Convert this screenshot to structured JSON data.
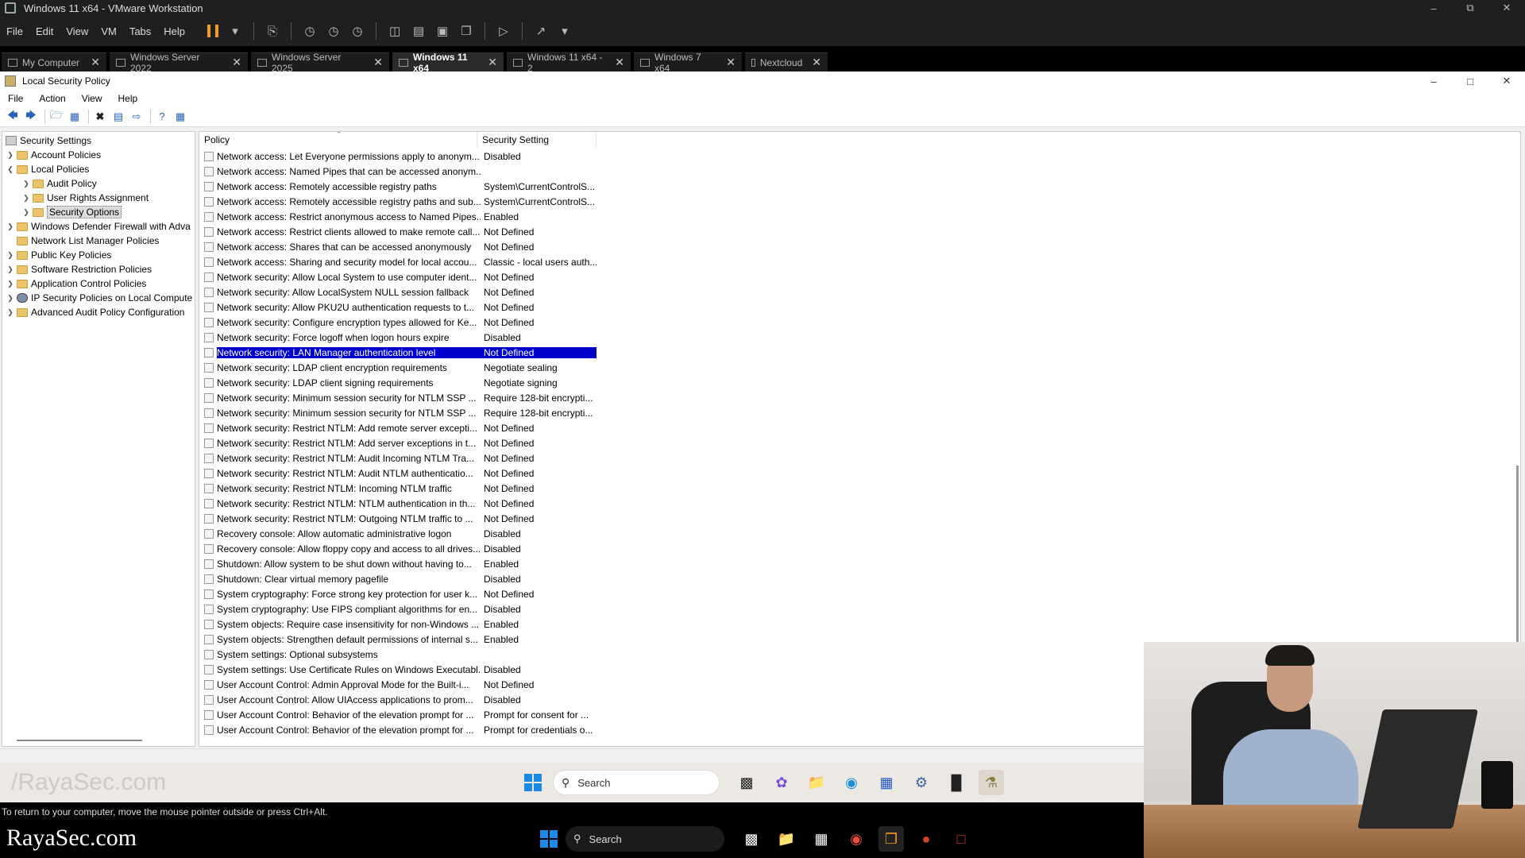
{
  "vmware": {
    "title": "Windows 11 x64 - VMware Workstation",
    "menu": [
      "File",
      "Edit",
      "View",
      "VM",
      "Tabs",
      "Help"
    ],
    "tabs": [
      {
        "label": "My Computer",
        "active": false
      },
      {
        "label": "Windows Server 2022",
        "active": false
      },
      {
        "label": "Windows Server 2025",
        "active": false
      },
      {
        "label": "Windows 11 x64",
        "active": true
      },
      {
        "label": "Windows 11 x64 - 2",
        "active": false
      },
      {
        "label": "Windows 7 x64",
        "active": false
      },
      {
        "label": "Nextcloud",
        "active": false
      }
    ],
    "hint": "To return to your computer, move the mouse pointer outside or press Ctrl+Alt."
  },
  "lsp": {
    "title": "Local Security Policy",
    "menu": [
      "File",
      "Action",
      "View",
      "Help"
    ]
  },
  "tree": [
    {
      "label": "Security Settings",
      "level": 0,
      "icon": "security-settings-icon",
      "arrow": ""
    },
    {
      "label": "Account Policies",
      "level": 1,
      "icon": "folder-icon",
      "arrow": ">"
    },
    {
      "label": "Local Policies",
      "level": 1,
      "icon": "folder-icon",
      "arrow": "v"
    },
    {
      "label": "Audit Policy",
      "level": 2,
      "icon": "folder-icon",
      "arrow": ">"
    },
    {
      "label": "User Rights Assignment",
      "level": 2,
      "icon": "folder-icon",
      "arrow": ">"
    },
    {
      "label": "Security Options",
      "level": 2,
      "icon": "folder-icon",
      "arrow": ">",
      "selected": true
    },
    {
      "label": "Windows Defender Firewall with Adva",
      "level": 1,
      "icon": "folder-icon",
      "arrow": ">"
    },
    {
      "label": "Network List Manager Policies",
      "level": 1,
      "icon": "folder-icon",
      "arrow": ""
    },
    {
      "label": "Public Key Policies",
      "level": 1,
      "icon": "folder-icon",
      "arrow": ">"
    },
    {
      "label": "Software Restriction Policies",
      "level": 1,
      "icon": "folder-icon",
      "arrow": ">"
    },
    {
      "label": "Application Control Policies",
      "level": 1,
      "icon": "folder-icon",
      "arrow": ">"
    },
    {
      "label": "IP Security Policies on Local Compute",
      "level": 1,
      "icon": "ip-security-icon",
      "arrow": ">"
    },
    {
      "label": "Advanced Audit Policy Configuration",
      "level": 1,
      "icon": "folder-icon",
      "arrow": ">"
    }
  ],
  "list": {
    "col_policy": "Policy",
    "col_setting": "Security Setting",
    "rows": [
      {
        "policy": "Network access: Let Everyone permissions apply to anonym...",
        "setting": "Disabled"
      },
      {
        "policy": "Network access: Named Pipes that can be accessed anonym...",
        "setting": ""
      },
      {
        "policy": "Network access: Remotely accessible registry paths",
        "setting": "System\\CurrentControlS..."
      },
      {
        "policy": "Network access: Remotely accessible registry paths and sub...",
        "setting": "System\\CurrentControlS..."
      },
      {
        "policy": "Network access: Restrict anonymous access to Named Pipes...",
        "setting": "Enabled"
      },
      {
        "policy": "Network access: Restrict clients allowed to make remote call...",
        "setting": "Not Defined"
      },
      {
        "policy": "Network access: Shares that can be accessed anonymously",
        "setting": "Not Defined"
      },
      {
        "policy": "Network access: Sharing and security model for local accou...",
        "setting": "Classic - local users auth..."
      },
      {
        "policy": "Network security: Allow Local System to use computer ident...",
        "setting": "Not Defined"
      },
      {
        "policy": "Network security: Allow LocalSystem NULL session fallback",
        "setting": "Not Defined"
      },
      {
        "policy": "Network security: Allow PKU2U authentication requests to t...",
        "setting": "Not Defined"
      },
      {
        "policy": "Network security: Configure encryption types allowed for Ke...",
        "setting": "Not Defined"
      },
      {
        "policy": "Network security: Force logoff when logon hours expire",
        "setting": "Disabled"
      },
      {
        "policy": "Network security: LAN Manager authentication level",
        "setting": "Not Defined",
        "selected": true
      },
      {
        "policy": "Network security: LDAP client encryption requirements",
        "setting": "Negotiate sealing"
      },
      {
        "policy": "Network security: LDAP client signing requirements",
        "setting": "Negotiate signing"
      },
      {
        "policy": "Network security: Minimum session security for NTLM SSP ...",
        "setting": "Require 128-bit encrypti..."
      },
      {
        "policy": "Network security: Minimum session security for NTLM SSP ...",
        "setting": "Require 128-bit encrypti..."
      },
      {
        "policy": "Network security: Restrict NTLM: Add remote server excepti...",
        "setting": "Not Defined"
      },
      {
        "policy": "Network security: Restrict NTLM: Add server exceptions in t...",
        "setting": "Not Defined"
      },
      {
        "policy": "Network security: Restrict NTLM: Audit Incoming NTLM Tra...",
        "setting": "Not Defined"
      },
      {
        "policy": "Network security: Restrict NTLM: Audit NTLM authenticatio...",
        "setting": "Not Defined"
      },
      {
        "policy": "Network security: Restrict NTLM: Incoming NTLM traffic",
        "setting": "Not Defined"
      },
      {
        "policy": "Network security: Restrict NTLM: NTLM authentication in th...",
        "setting": "Not Defined"
      },
      {
        "policy": "Network security: Restrict NTLM: Outgoing NTLM traffic to ...",
        "setting": "Not Defined"
      },
      {
        "policy": "Recovery console: Allow automatic administrative logon",
        "setting": "Disabled"
      },
      {
        "policy": "Recovery console: Allow floppy copy and access to all drives...",
        "setting": "Disabled"
      },
      {
        "policy": "Shutdown: Allow system to be shut down without having to...",
        "setting": "Enabled"
      },
      {
        "policy": "Shutdown: Clear virtual memory pagefile",
        "setting": "Disabled"
      },
      {
        "policy": "System cryptography: Force strong key protection for user k...",
        "setting": "Not Defined"
      },
      {
        "policy": "System cryptography: Use FIPS compliant algorithms for en...",
        "setting": "Disabled"
      },
      {
        "policy": "System objects: Require case insensitivity for non-Windows ...",
        "setting": "Enabled"
      },
      {
        "policy": "System objects: Strengthen default permissions of internal s...",
        "setting": "Enabled"
      },
      {
        "policy": "System settings: Optional subsystems",
        "setting": ""
      },
      {
        "policy": "System settings: Use Certificate Rules on Windows Executabl...",
        "setting": "Disabled"
      },
      {
        "policy": "User Account Control: Admin Approval Mode for the Built-i...",
        "setting": "Not Defined"
      },
      {
        "policy": "User Account Control: Allow UIAccess applications to prom...",
        "setting": "Disabled"
      },
      {
        "policy": "User Account Control: Behavior of the elevation prompt for ...",
        "setting": "Prompt for consent for ..."
      },
      {
        "policy": "User Account Control: Behavior of the elevation prompt for ...",
        "setting": "Prompt for credentials o..."
      }
    ]
  },
  "guest_taskbar": {
    "watermark": "/RayaSec.com",
    "search_label": "Search"
  },
  "host_taskbar": {
    "brand": "RayaSec.com",
    "search_label": "Search"
  }
}
